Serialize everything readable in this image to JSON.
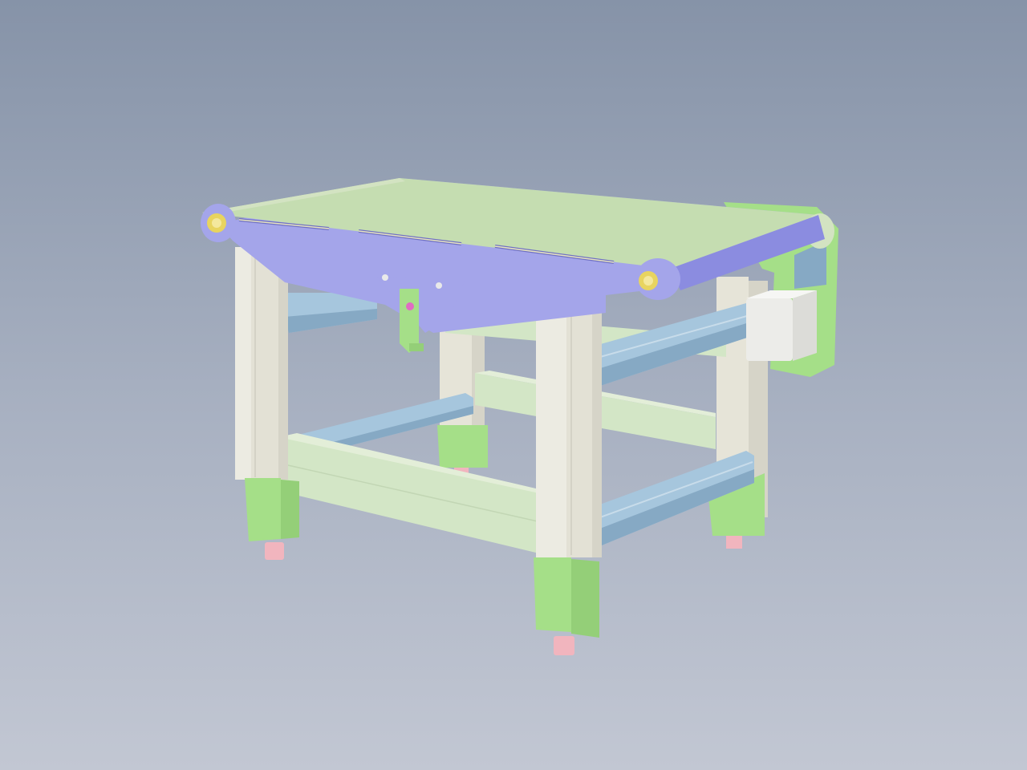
{
  "viewport": {
    "background_top": "#8693a8",
    "background_bottom": "#c2c7d3"
  },
  "model": {
    "colors": {
      "belt": "#c5ddb1",
      "belt_edge": "#d3e3c2",
      "side_frame": "#a4a5ea",
      "side_frame_dark": "#8b8ce0",
      "upright_profile": "#ecebe2",
      "upright_shadow": "#d8d6ca",
      "cross_beam": "#d3e6c6",
      "rail": "#a6c6dd",
      "rail_dark": "#86a9c4",
      "foot_bracket": "#a5df88",
      "leveling_foot": "#f1b5be",
      "motor": "#ecece9",
      "motor_mount": "#a5df88",
      "pulley": "#e8d45f",
      "sensor_bracket": "#a5df88",
      "sensor": "#e06bc3"
    }
  }
}
